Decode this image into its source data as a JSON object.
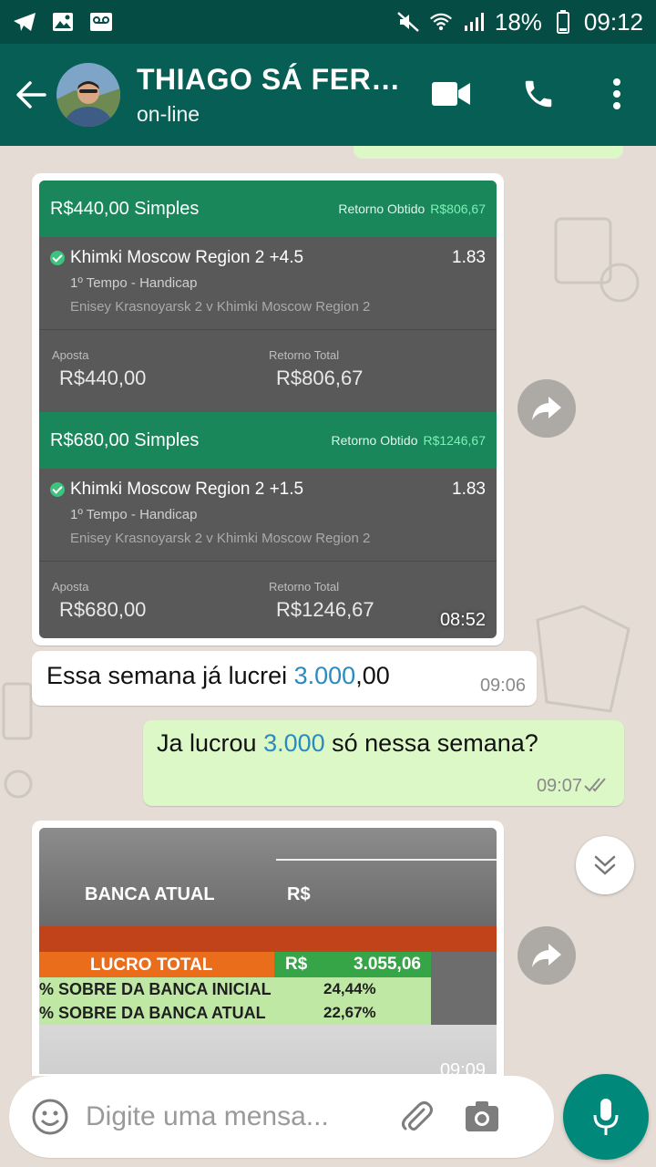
{
  "status_bar": {
    "battery": "18%",
    "time": "09:12"
  },
  "header": {
    "contact_name": "THIAGO SÁ FERR...",
    "status": "on-line"
  },
  "messages": {
    "bet_screenshot": {
      "bets": [
        {
          "stake_title": "R$440,00 Simples",
          "return_label": "Retorno Obtido",
          "return_value": "R$806,67",
          "selection": "Khimki Moscow Region 2 +4.5",
          "odds": "1.83",
          "market": "1º Tempo - Handicap",
          "event": "Enisey Krasnoyarsk 2 v Khimki Moscow Region 2",
          "stake_label": "Aposta",
          "stake_value": "R$440,00",
          "total_label": "Retorno Total",
          "total_value": "R$806,67"
        },
        {
          "stake_title": "R$680,00 Simples",
          "return_label": "Retorno Obtido",
          "return_value": "R$1246,67",
          "selection": "Khimki Moscow Region 2 +1.5",
          "odds": "1.83",
          "market": "1º Tempo - Handicap",
          "event": "Enisey Krasnoyarsk 2 v Khimki Moscow Region 2",
          "stake_label": "Aposta",
          "stake_value": "R$680,00",
          "total_label": "Retorno Total",
          "total_value": "R$1246,67"
        }
      ],
      "time": "08:52"
    },
    "incoming_text": {
      "before": "Essa semana já lucrei ",
      "highlight": "3.000",
      "after": ",00",
      "time": "09:06"
    },
    "outgoing_text": {
      "before": "Ja lucrou ",
      "highlight": "3.000",
      "after": " só nessa semana?",
      "time": "09:07"
    },
    "spreadsheet_photo": {
      "banca_label": "BANCA ATUAL",
      "banca_currency": "R$",
      "lucro_label": "LUCRO TOTAL",
      "lucro_currency": "R$",
      "lucro_value": "3.055,06",
      "pct_initial_label": "% SOBRE DA BANCA INICIAL",
      "pct_initial_value": "24,44%",
      "pct_current_label": "% SOBRE DA BANCA ATUAL",
      "pct_current_value": "22,67%",
      "time": "09:09"
    }
  },
  "input": {
    "placeholder": "Digite uma mensa..."
  },
  "colors": {
    "header": "#075e54",
    "status_bar": "#054d44",
    "outgoing": "#dcf8c6",
    "accent": "#00897b",
    "link": "#2a8bc1"
  },
  "icons": [
    "telegram-icon",
    "image-icon",
    "voicemail-icon",
    "mute-icon",
    "wifi-icon",
    "signal-icon",
    "battery-icon",
    "back-arrow-icon",
    "video-call-icon",
    "phone-icon",
    "more-vert-icon",
    "forward-icon",
    "double-check-icon",
    "chevron-double-down-icon",
    "emoji-icon",
    "attach-icon",
    "camera-icon",
    "mic-icon"
  ]
}
